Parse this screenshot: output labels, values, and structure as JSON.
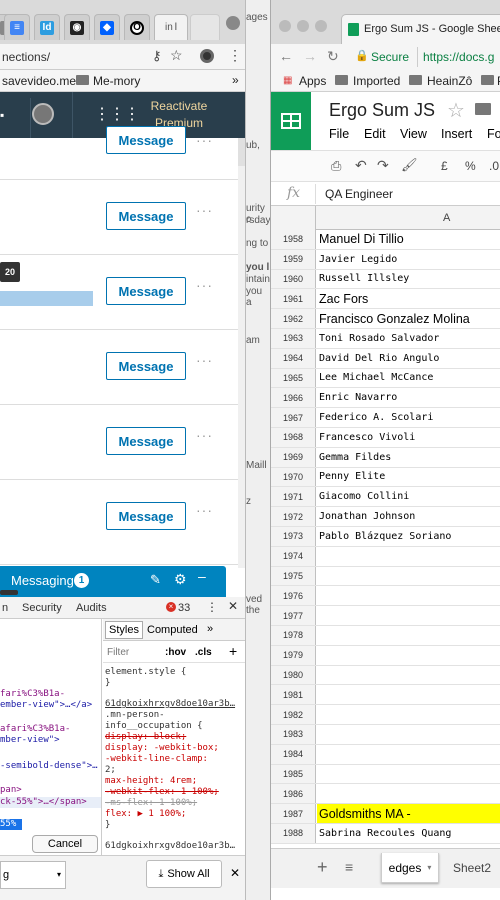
{
  "left_window": {
    "tab_title_fragment": "l",
    "url": "nections/",
    "bookmarks": [
      {
        "label": "savevideo.me"
      },
      {
        "label": "Me-mory"
      }
    ],
    "bookmarks_more": "»",
    "linkedin": {
      "reactivate_line1": "Reactivate",
      "reactivate_line2": "Premium"
    },
    "rows": [
      {
        "button": "Message",
        "more": "···"
      },
      {
        "button": "Message",
        "more": "···"
      },
      {
        "button": "Message",
        "more": "···"
      },
      {
        "button": "Message",
        "more": "···"
      },
      {
        "button": "Message",
        "more": "···"
      },
      {
        "button": "Message",
        "more": "···"
      }
    ],
    "tooltip_value": "20",
    "messaging": {
      "label": "Messaging",
      "count": "1"
    },
    "devtools": {
      "tabs": [
        "n",
        "Security",
        "Audits"
      ],
      "error_count": "33",
      "styles_tabs": [
        "Styles",
        "Computed",
        "»"
      ],
      "filter_label": "Filter",
      "hov_label": ":hov",
      "cls_label": ".cls",
      "dom_lines": [
        "fari%C3%B1a-",
        "ember-view\">…</a>",
        "afari%C3%B1a-",
        "mber-view\">",
        "-semibold-dense\">…",
        "pan>",
        "ck-55%\">…</span>",
        "55%"
      ],
      "style_lines": [
        "element.style {",
        "}",
        "61dgkoixhrxgv8doe10ar3b…",
        ".mn-person-",
        "info__occupation {",
        "  display: block;",
        "  display: -webkit-box;",
        "  -webkit-line-clamp:",
        "    2;",
        "  max-height: 4rem;",
        "  -webkit-flex: 1 100%;",
        "  -ms-flex: 1 100%;",
        "  flex: ▶ 1 100%;",
        "}",
        "61dgkoixhrxgv8doe10ar3b…"
      ],
      "cancel_label": "Cancel",
      "select_value": "g"
    },
    "downloads": {
      "show_all": "Show All"
    }
  },
  "ghost_window": {
    "lines": [
      "ages",
      "ub,",
      "urity c",
      "rsday",
      "ng to",
      "you l",
      "intain",
      "you a",
      "am",
      "Maill",
      "z",
      "ved the"
    ]
  },
  "right_window": {
    "tab_title": "Ergo Sum JS - Google Sheet",
    "secure_label": "Secure",
    "url": "https://docs.g",
    "bookmarks": [
      {
        "label": "Apps"
      },
      {
        "label": "Imported"
      },
      {
        "label": "HeainZô"
      },
      {
        "label": "P"
      }
    ],
    "sheet": {
      "title": "Ergo Sum JS",
      "menus": [
        "File",
        "Edit",
        "View",
        "Insert",
        "Fo"
      ],
      "toolbar_currency": "£",
      "toolbar_percent": "%",
      "toolbar_decimal": ".0",
      "fx_label": "fx",
      "formula_value": "QA Engineer",
      "column_header": "A",
      "rows": [
        {
          "num": "1958",
          "value": "Manuel Di Tillio",
          "style": "sans"
        },
        {
          "num": "1959",
          "value": "Javier Legido",
          "style": "mono"
        },
        {
          "num": "1960",
          "value": "Russell Illsley",
          "style": "mono"
        },
        {
          "num": "1961",
          "value": "Zac Fors",
          "style": "sans"
        },
        {
          "num": "1962",
          "value": "Francisco Gonzalez Molina",
          "style": "sans"
        },
        {
          "num": "1963",
          "value": "Toni Rosado Salvador",
          "style": "mono"
        },
        {
          "num": "1964",
          "value": "David Del Rio Angulo",
          "style": "mono"
        },
        {
          "num": "1965",
          "value": "Lee Michael McCance",
          "style": "mono"
        },
        {
          "num": "1966",
          "value": "Enric Navarro",
          "style": "mono"
        },
        {
          "num": "1967",
          "value": "Federico A. Scolari",
          "style": "mono"
        },
        {
          "num": "1968",
          "value": "Francesco Vivoli",
          "style": "mono"
        },
        {
          "num": "1969",
          "value": "Gemma Fildes",
          "style": "mono"
        },
        {
          "num": "1970",
          "value": "Penny Elite",
          "style": "mono"
        },
        {
          "num": "1971",
          "value": "Giacomo Collini",
          "style": "mono"
        },
        {
          "num": "1972",
          "value": "Jonathan Johnson",
          "style": "mono"
        },
        {
          "num": "1973",
          "value": "Pablo Blázquez Soriano",
          "style": "mono"
        },
        {
          "num": "1974",
          "value": "",
          "style": "mono"
        },
        {
          "num": "1975",
          "value": "",
          "style": "mono"
        },
        {
          "num": "1976",
          "value": "",
          "style": "mono"
        },
        {
          "num": "1977",
          "value": "",
          "style": "mono"
        },
        {
          "num": "1978",
          "value": "",
          "style": "mono"
        },
        {
          "num": "1979",
          "value": "",
          "style": "mono"
        },
        {
          "num": "1980",
          "value": "",
          "style": "mono"
        },
        {
          "num": "1981",
          "value": "",
          "style": "mono"
        },
        {
          "num": "1982",
          "value": "",
          "style": "mono"
        },
        {
          "num": "1983",
          "value": "",
          "style": "mono"
        },
        {
          "num": "1984",
          "value": "",
          "style": "mono"
        },
        {
          "num": "1985",
          "value": "",
          "style": "mono"
        },
        {
          "num": "1986",
          "value": "",
          "style": "mono"
        },
        {
          "num": "1987",
          "value": "Goldsmiths MA -",
          "style": "highlight"
        },
        {
          "num": "1988",
          "value": "Sabrina Recoules Quang",
          "style": "mono"
        }
      ],
      "sheet_tabs": [
        {
          "label": "edges"
        },
        {
          "label": "Sheet2"
        }
      ]
    }
  },
  "colors": {
    "linkedin_nav": "#293e4c",
    "linkedin_blue": "#0073b1",
    "messaging_bar": "#0084bf",
    "sheets_green": "#0f9d58",
    "highlight_yellow": "#ffff00",
    "secure_green": "#0b8043"
  }
}
